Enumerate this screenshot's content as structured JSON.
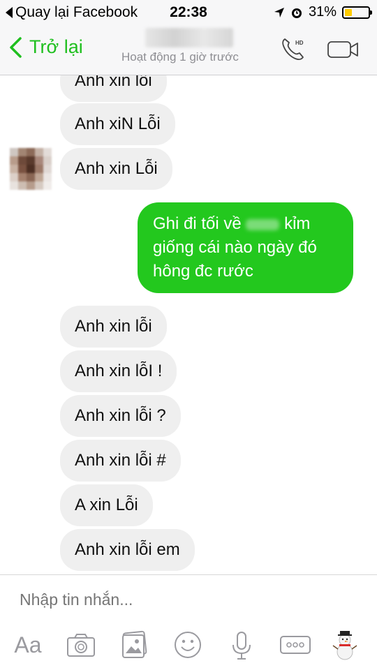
{
  "status_bar": {
    "back_label": "Quay lại Facebook",
    "time": "22:38",
    "battery_percent": "31%",
    "battery_level": 0.31,
    "battery_color": "#ffcc00"
  },
  "nav": {
    "back_label": "Trở lại",
    "subtitle": "Hoạt động 1 giờ trước",
    "accent_color": "#1fbf1f",
    "phone_icon_badge": "HD"
  },
  "messages": [
    {
      "direction": "in",
      "text": "Anh xin lỗi"
    },
    {
      "direction": "in",
      "text": "Anh xiN Lỗi"
    },
    {
      "direction": "in",
      "text": "Anh xin Lỗi"
    },
    {
      "direction": "out",
      "lines": [
        "Ghi đi tối về",
        "kỉm",
        "giống cái nào ngày đó",
        "hông đc rước"
      ]
    },
    {
      "direction": "in",
      "text": "Anh xin lỗi"
    },
    {
      "direction": "in",
      "text": "Anh xin lỗI !"
    },
    {
      "direction": "in",
      "text": "Anh xin lỗi ?"
    },
    {
      "direction": "in",
      "text": "Anh xin lỗi #"
    },
    {
      "direction": "in",
      "text": "A xin Lỗi"
    },
    {
      "direction": "in",
      "text": "Anh xin lỗi em"
    }
  ],
  "composer": {
    "placeholder": "Nhập tin nhắn...",
    "aa_label": "Aa",
    "tools": [
      "aa-icon",
      "camera-icon",
      "gallery-icon",
      "emoji-icon",
      "microphone-icon",
      "more-icon",
      "snowman-sticker-icon"
    ]
  },
  "colors": {
    "outgoing_bubble": "#23c81e",
    "incoming_bubble": "#efefef",
    "toolbar_icon": "#9a9a9f"
  }
}
